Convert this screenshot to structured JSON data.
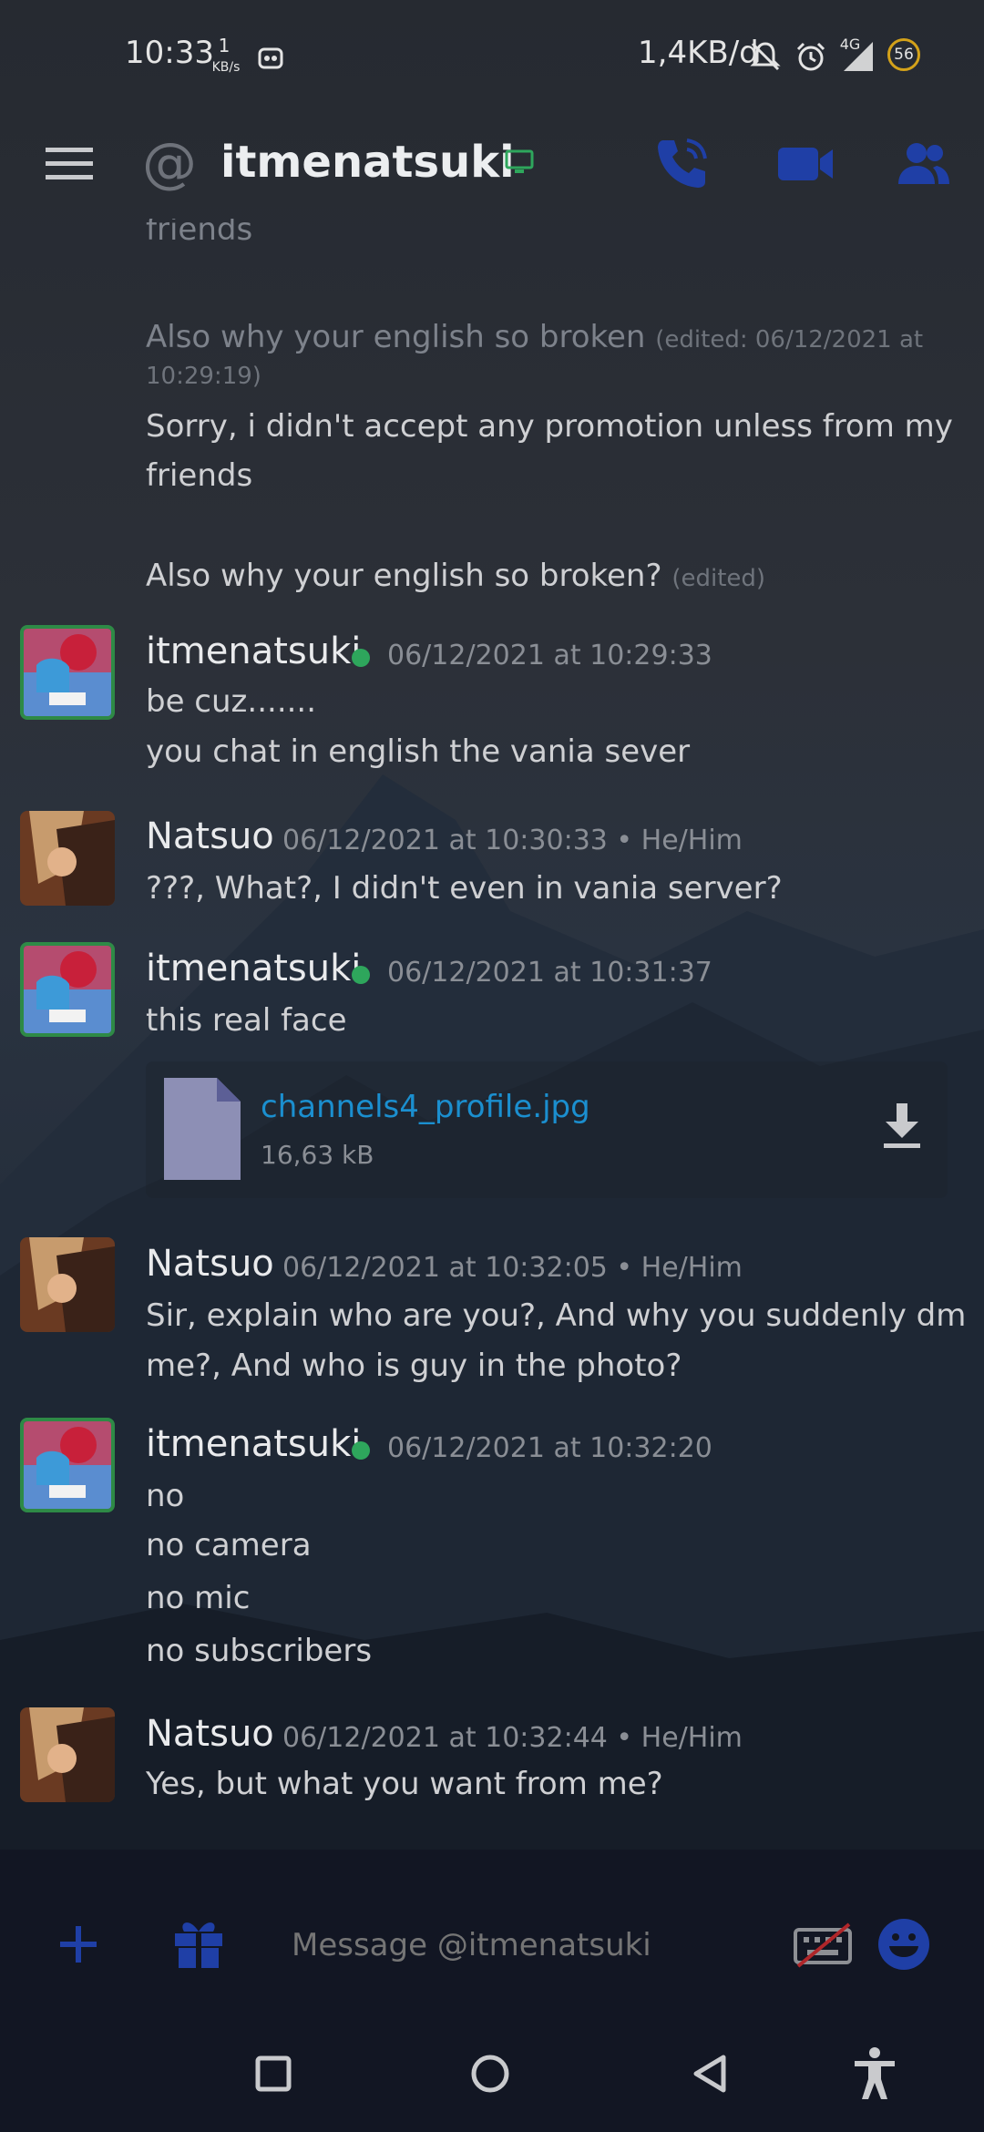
{
  "status_bar": {
    "time": "10:33",
    "speed_value": "1",
    "speed_unit": "KB/s",
    "data_usage": "1,4KB/d",
    "network": "4G",
    "battery": "56"
  },
  "header": {
    "at_symbol": "@",
    "title": "itmenatsuki"
  },
  "messages": {
    "prev_partial": "friends",
    "prev_edit_line": "Also why your english so broken",
    "prev_edit_meta_1": "(edited: 06/12/2021 at",
    "prev_edit_meta_2": "10:29:19)",
    "prev_line1": "Sorry, i didn't accept any promotion unless from my",
    "prev_line2": "friends",
    "prev_line3": "Also why your english so broken?",
    "prev_line3_edited": "(edited)",
    "groups": [
      {
        "author": "itmenatsuki",
        "timestamp": "06/12/2021 at 10:29:33",
        "lines": [
          "be cuz.......",
          "you chat in english the vania sever"
        ]
      },
      {
        "author": "Natsuo",
        "timestamp": "06/12/2021 at 10:30:33 • He/Him",
        "lines": [
          "???, What?, I didn't even in vania server?"
        ]
      },
      {
        "author": "itmenatsuki",
        "timestamp": "06/12/2021 at 10:31:37",
        "lines": [
          "this real face"
        ],
        "attachment": {
          "filename": "channels4_profile.jpg",
          "size": "16,63 kB"
        }
      },
      {
        "author": "Natsuo",
        "timestamp": "06/12/2021 at 10:32:05 • He/Him",
        "lines": [
          "Sir, explain who are you?, And why you suddenly dm",
          "me?, And who is guy in the photo?"
        ]
      },
      {
        "author": "itmenatsuki",
        "timestamp": "06/12/2021 at 10:32:20",
        "lines": [
          "no",
          "no camera",
          "no mic",
          "no subscribers"
        ]
      },
      {
        "author": "Natsuo",
        "timestamp": "06/12/2021 at 10:32:44 • He/Him",
        "lines": [
          "Yes, but what you want from me?"
        ]
      }
    ]
  },
  "input": {
    "placeholder": "Message @itmenatsuki"
  },
  "colors": {
    "accent_blue": "#1f3fa6",
    "online_green": "#2ea65c",
    "link_blue": "#1b8fcf"
  }
}
